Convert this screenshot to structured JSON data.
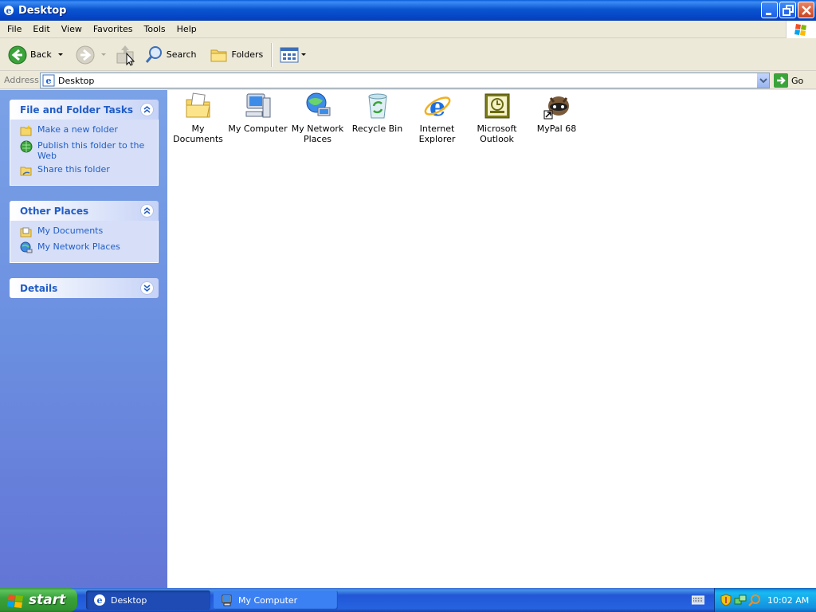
{
  "window": {
    "title": "Desktop",
    "controls": [
      "minimize-icon",
      "restore-icon",
      "close-icon"
    ]
  },
  "menubar": {
    "items": [
      "File",
      "Edit",
      "View",
      "Favorites",
      "Tools",
      "Help"
    ]
  },
  "toolbar": {
    "back_label": "Back",
    "search_label": "Search",
    "folders_label": "Folders"
  },
  "address": {
    "label": "Address",
    "value": "Desktop",
    "go_label": "Go"
  },
  "sidebar": {
    "panels": [
      {
        "title": "File and Folder Tasks",
        "items": [
          {
            "label": "Make a new folder",
            "icon": "new-folder-icon"
          },
          {
            "label": "Publish this folder to the Web",
            "icon": "publish-web-icon"
          },
          {
            "label": "Share this folder",
            "icon": "share-folder-icon"
          }
        ]
      },
      {
        "title": "Other Places",
        "items": [
          {
            "label": "My Documents",
            "icon": "my-documents-icon"
          },
          {
            "label": "My Network Places",
            "icon": "network-places-icon"
          }
        ]
      },
      {
        "title": "Details",
        "items": []
      }
    ]
  },
  "desktop_icons": [
    {
      "label": "My Documents",
      "icon": "my-documents-icon"
    },
    {
      "label": "My Computer",
      "icon": "my-computer-icon"
    },
    {
      "label": "My Network Places",
      "icon": "network-places-icon"
    },
    {
      "label": "Recycle Bin",
      "icon": "recycle-bin-icon"
    },
    {
      "label": "Internet Explorer",
      "icon": "internet-explorer-icon"
    },
    {
      "label": "Microsoft Outlook",
      "icon": "outlook-icon"
    },
    {
      "label": "MyPal 68",
      "icon": "mypal-icon"
    }
  ],
  "taskbar": {
    "start_label": "start",
    "tasks": [
      {
        "label": "Desktop",
        "active": true
      },
      {
        "label": "My Computer",
        "active": false
      }
    ],
    "clock": "10:02 AM"
  },
  "colors": {
    "title_blue": "#0a55d0",
    "link_blue": "#215dc6",
    "sidebar_blue": "#6b8fe0",
    "start_green": "#3aa33a"
  }
}
